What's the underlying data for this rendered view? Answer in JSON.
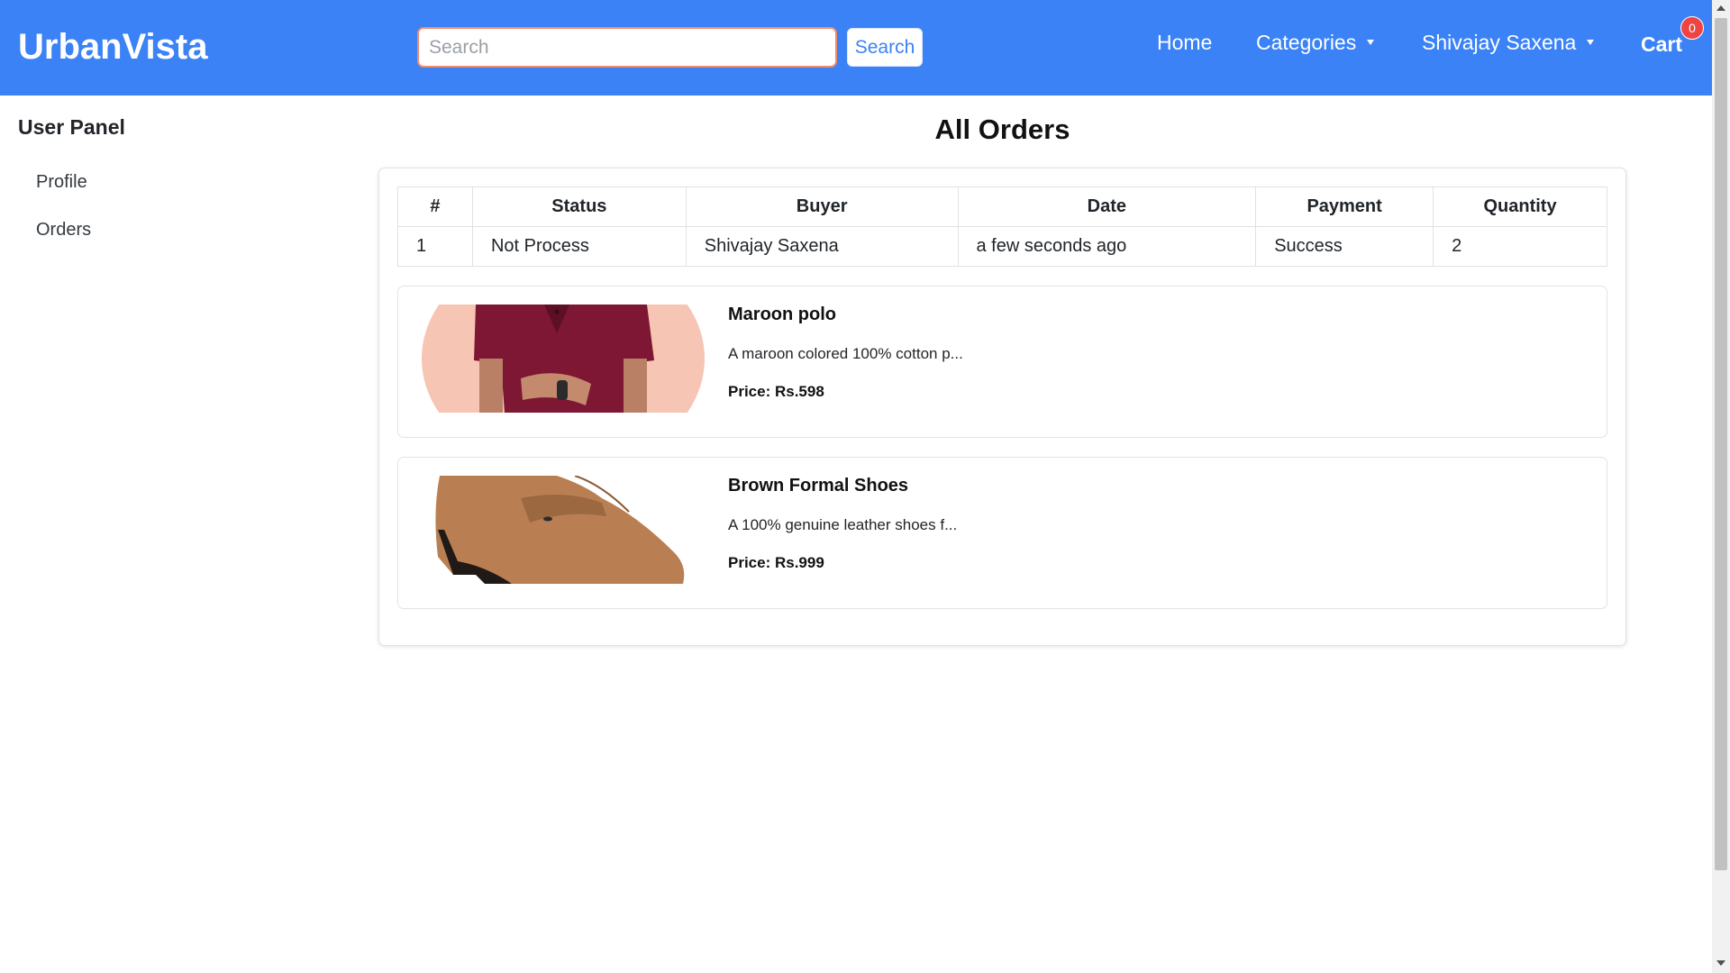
{
  "navbar": {
    "brand": "UrbanVista",
    "search_placeholder": "Search",
    "search_value": "",
    "search_button": "Search",
    "links": {
      "home": "Home",
      "categories": "Categories",
      "user": "Shivajay Saxena",
      "cart": "Cart"
    },
    "cart_count": "0"
  },
  "sidebar": {
    "title": "User Panel",
    "items": [
      "Profile",
      "Orders"
    ]
  },
  "main": {
    "title": "All Orders",
    "table": {
      "headers": [
        "#",
        "Status",
        "Buyer",
        "Date",
        "Payment",
        "Quantity"
      ],
      "rows": [
        [
          "1",
          "Not Process",
          "Shivajay Saxena",
          "a few seconds ago",
          "Success",
          "2"
        ]
      ]
    },
    "products": [
      {
        "name": "Maroon polo",
        "description": "A maroon colored 100% cotton p...",
        "price": "Price: Rs.598",
        "image_icon": "maroon-polo-image"
      },
      {
        "name": "Brown Formal Shoes",
        "description": "A 100% genuine leather shoes f...",
        "price": "Price: Rs.999",
        "image_icon": "brown-shoes-image"
      }
    ]
  },
  "colors": {
    "navbar": "#3b82f6",
    "badge": "#ef4444",
    "search_border": "#f28b6a"
  }
}
